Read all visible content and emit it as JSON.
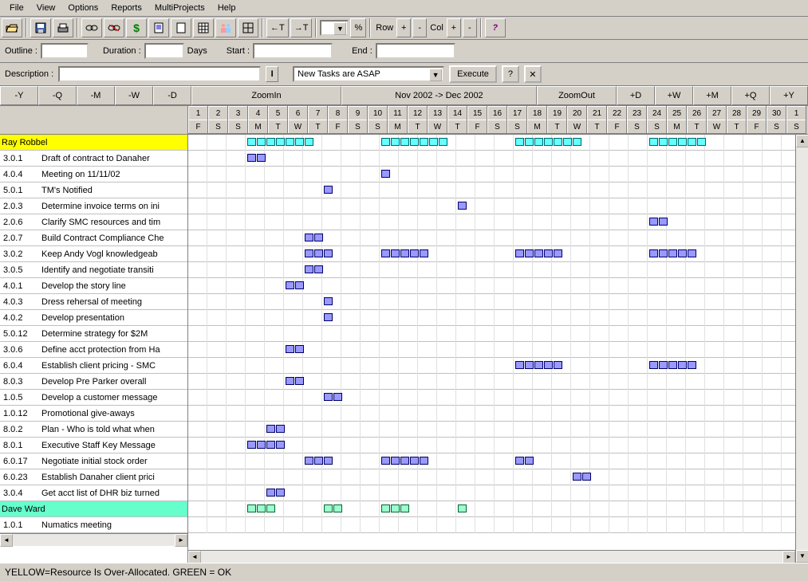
{
  "menu": [
    "File",
    "View",
    "Options",
    "Reports",
    "MultiProjects",
    "Help"
  ],
  "toolbar": {
    "t_row": "Row",
    "t_col": "Col",
    "indent_left": "←T",
    "indent_right": "→T",
    "percent": "%"
  },
  "fields": {
    "outline_lbl": "Outline :",
    "duration_lbl": "Duration :",
    "days_lbl": "Days",
    "start_lbl": "Start :",
    "end_lbl": "End :",
    "desc_lbl": "Description :",
    "mode": "New Tasks are ASAP",
    "execute": "Execute",
    "help": "?",
    "close": "✕"
  },
  "zoom": {
    "left": [
      "-Y",
      "-Q",
      "-M",
      "-W",
      "-D"
    ],
    "zin": "ZoomIn",
    "title": "Nov  2002 -> Dec  2002",
    "zout": "ZoomOut",
    "right": [
      "+D",
      "+W",
      "+M",
      "+Q",
      "+Y"
    ]
  },
  "days": {
    "nums": [
      "1",
      "2",
      "3",
      "4",
      "5",
      "6",
      "7",
      "8",
      "9",
      "10",
      "11",
      "12",
      "13",
      "14",
      "15",
      "16",
      "17",
      "18",
      "19",
      "20",
      "21",
      "22",
      "23",
      "24",
      "25",
      "26",
      "27",
      "28",
      "29",
      "30",
      "1"
    ],
    "dow": [
      "F",
      "S",
      "S",
      "M",
      "T",
      "W",
      "T",
      "F",
      "S",
      "S",
      "M",
      "T",
      "W",
      "T",
      "F",
      "S",
      "S",
      "M",
      "T",
      "W",
      "T",
      "F",
      "S",
      "S",
      "M",
      "T",
      "W",
      "T",
      "F",
      "S",
      "S"
    ]
  },
  "tasks": [
    {
      "wbs": "",
      "name": "Ray Robbel",
      "resource": "yellow",
      "bars": [
        {
          "start": 3,
          "len": 7,
          "color": "cyan"
        },
        {
          "start": 10,
          "len": 7,
          "color": "cyan"
        },
        {
          "start": 17,
          "len": 7,
          "color": "cyan"
        },
        {
          "start": 24,
          "len": 6,
          "color": "cyan"
        }
      ]
    },
    {
      "wbs": "3.0.1",
      "name": "Draft of contract to Danaher",
      "bars": [
        {
          "start": 3,
          "len": 2
        }
      ]
    },
    {
      "wbs": "4.0.4",
      "name": "Meeting on 11/11/02",
      "bars": [
        {
          "start": 10,
          "len": 1
        }
      ]
    },
    {
      "wbs": "5.0.1",
      "name": "TM's Notified",
      "bars": [
        {
          "start": 7,
          "len": 1
        }
      ]
    },
    {
      "wbs": "2.0.3",
      "name": "Determine invoice terms on ini",
      "bars": [
        {
          "start": 14,
          "len": 1
        }
      ]
    },
    {
      "wbs": "2.0.6",
      "name": "Clarify SMC resources and tim",
      "bars": [
        {
          "start": 24,
          "len": 2
        }
      ]
    },
    {
      "wbs": "2.0.7",
      "name": "Build Contract Compliance Che",
      "bars": [
        {
          "start": 6,
          "len": 2
        }
      ]
    },
    {
      "wbs": "3.0.2",
      "name": "Keep Andy Vogl knowledgeab",
      "bars": [
        {
          "start": 6,
          "len": 3
        },
        {
          "start": 10,
          "len": 5
        },
        {
          "start": 17,
          "len": 5
        },
        {
          "start": 24,
          "len": 5
        }
      ]
    },
    {
      "wbs": "3.0.5",
      "name": "Identify and negotiate transiti",
      "bars": [
        {
          "start": 6,
          "len": 2
        }
      ]
    },
    {
      "wbs": "4.0.1",
      "name": "Develop the story line",
      "bars": [
        {
          "start": 5,
          "len": 2
        }
      ]
    },
    {
      "wbs": "4.0.3",
      "name": "Dress rehersal of meeting",
      "bars": [
        {
          "start": 7,
          "len": 1
        }
      ]
    },
    {
      "wbs": "4.0.2",
      "name": "Develop presentation",
      "bars": [
        {
          "start": 7,
          "len": 1
        }
      ]
    },
    {
      "wbs": "5.0.12",
      "name": "Determine strategy for $2M",
      "bars": []
    },
    {
      "wbs": "3.0.6",
      "name": "Define acct protection from Ha",
      "bars": [
        {
          "start": 5,
          "len": 2
        }
      ]
    },
    {
      "wbs": "6.0.4",
      "name": "Establish client pricing - SMC",
      "bars": [
        {
          "start": 17,
          "len": 5
        },
        {
          "start": 24,
          "len": 5
        }
      ]
    },
    {
      "wbs": "8.0.3",
      "name": "Develop Pre Parker overall",
      "bars": [
        {
          "start": 5,
          "len": 2
        }
      ]
    },
    {
      "wbs": "1.0.5",
      "name": "Develop a customer message",
      "bars": [
        {
          "start": 7,
          "len": 2
        }
      ]
    },
    {
      "wbs": "1.0.12",
      "name": "Promotional give-aways",
      "bars": []
    },
    {
      "wbs": "8.0.2",
      "name": "Plan - Who is told what when",
      "bars": [
        {
          "start": 4,
          "len": 2
        }
      ]
    },
    {
      "wbs": "8.0.1",
      "name": "Executive Staff Key Message",
      "bars": [
        {
          "start": 3,
          "len": 4
        }
      ]
    },
    {
      "wbs": "6.0.17",
      "name": "Negotiate initial stock order",
      "bars": [
        {
          "start": 6,
          "len": 3
        },
        {
          "start": 10,
          "len": 5
        },
        {
          "start": 17,
          "len": 2
        }
      ]
    },
    {
      "wbs": "6.0.23",
      "name": "Establish Danaher client prici",
      "bars": [
        {
          "start": 20,
          "len": 2
        }
      ]
    },
    {
      "wbs": "3.0.4",
      "name": "Get acct list of DHR biz turned",
      "bars": [
        {
          "start": 4,
          "len": 2
        }
      ]
    },
    {
      "wbs": "",
      "name": "Dave Ward",
      "resource": "green",
      "bars": [
        {
          "start": 3,
          "len": 3,
          "color": "green"
        },
        {
          "start": 7,
          "len": 2,
          "color": "green"
        },
        {
          "start": 10,
          "len": 3,
          "color": "green"
        },
        {
          "start": 14,
          "len": 1,
          "color": "green"
        }
      ]
    },
    {
      "wbs": "1.0.1",
      "name": "Numatics meeting",
      "bars": []
    }
  ],
  "status": "YELLOW=Resource Is Over-Allocated.   GREEN = OK"
}
